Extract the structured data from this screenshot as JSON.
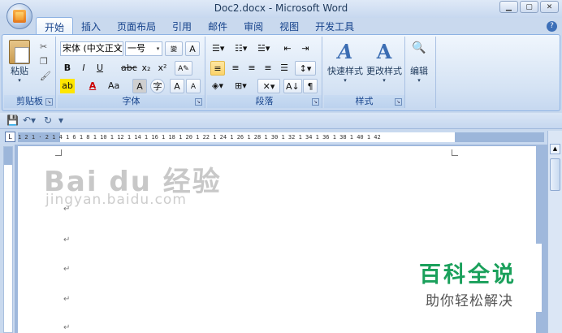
{
  "window": {
    "title": "Doc2.docx - Microsoft Word",
    "minimize": "▁",
    "maximize": "▢",
    "close": "✕"
  },
  "tabs": [
    "开始",
    "插入",
    "页面布局",
    "引用",
    "邮件",
    "审阅",
    "视图",
    "开发工具"
  ],
  "help": "?",
  "clipboard": {
    "paste_label": "粘贴",
    "group_label": "剪贴板"
  },
  "font": {
    "name": "宋体 (中文正文)",
    "size": "一号",
    "group_label": "字体",
    "bold": "B",
    "italic": "I",
    "underline": "U",
    "strike": "abc",
    "sub": "x₂",
    "sup": "x²",
    "change_case": "Aa",
    "grow": "A",
    "shrink": "A",
    "phonetic": "wén",
    "pinyin": "變",
    "border": "A"
  },
  "paragraph": {
    "group_label": "段落"
  },
  "styles": {
    "quick_label": "快速样式",
    "change_label": "更改样式",
    "group_label": "样式"
  },
  "editing": {
    "label": "编辑"
  },
  "ruler": {
    "numbers": "1 2 1 · 2 1 4 1 6 1 8 1 10 1 12 1 14 1 16 1 18 1 20 1 22 1 24 1 26 1 28 1 30 1 32 1 34 1 36 1 38 1 40 1 42"
  },
  "watermark": {
    "brand": "Bai du 经验",
    "url": "jingyan.baidu.com"
  },
  "badge": {
    "title": "百科全说",
    "subtitle": "助你轻松解决"
  },
  "paragraph_mark": "↵"
}
